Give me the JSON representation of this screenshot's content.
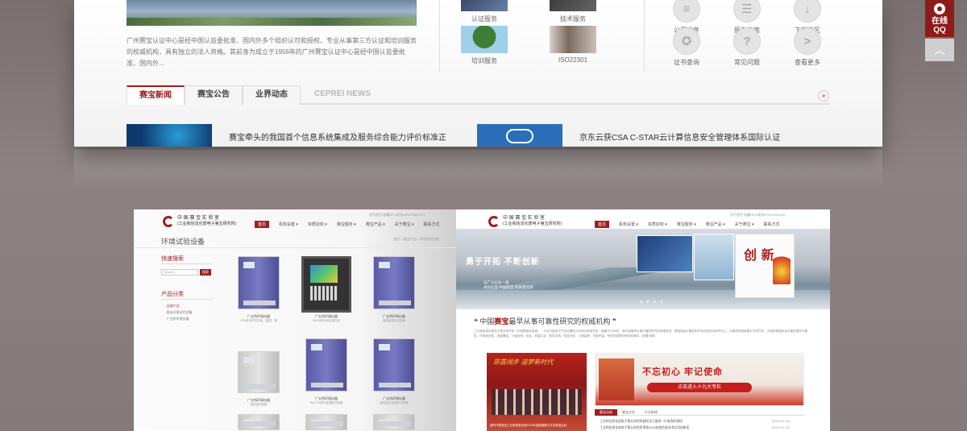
{
  "top": {
    "intro": "广州赛宝认证中心是经中国认监委批准、国内外多个组织认可和授权、专业从事第三方认证和培训服务的权威机构，具有独立的法人资格。其前身为成立于1956年的广州赛宝认证中心是经中国认监委批准、国内外...",
    "services": [
      {
        "label": "认证服务"
      },
      {
        "label": "技术服务"
      },
      {
        "label": "培训服务"
      },
      {
        "label": "ISO22301"
      }
    ],
    "icons": [
      {
        "label": "公开文件",
        "icon": "document-icon"
      },
      {
        "label": "服务指南",
        "icon": "guide-icon"
      },
      {
        "label": "下载专区",
        "icon": "download-icon"
      },
      {
        "label": "证书查询",
        "icon": "certificate-icon"
      },
      {
        "label": "常见问题",
        "icon": "question-icon"
      },
      {
        "label": "查看更多",
        "icon": "chevron-right-icon",
        "glyph": ">"
      }
    ],
    "side_qq": {
      "line1": "在线",
      "line2": "QQ"
    },
    "side_top_glyph": "︿",
    "tabs": [
      "赛宝新闻",
      "赛宝公告",
      "业界动态",
      "CEPREI NEWS"
    ],
    "tab_more": "»",
    "news": [
      {
        "title": "赛宝牵头的我国首个信息系统集成及服务综合能力评价标准正"
      },
      {
        "title": "京东云获CSA C-STAR云计算信息安全管理体系国际认证"
      }
    ],
    "colors": {
      "brand": "#a01d1d"
    }
  },
  "left_screen": {
    "logo_line1": "中 国 赛 宝 实 验 室",
    "logo_line2": "(工业和信息化部电子第五研究所)",
    "toplinks": "设为首页   收藏OPA   联系OPA   ENGLISH",
    "nav": [
      "首页",
      "机构设置 ▾",
      "资质授权 ▾",
      "赛宝服务 ▾",
      "赛宝产品 ▾",
      "关于赛宝 ▾",
      "联系方式"
    ],
    "page_title": "环境试验设备",
    "crumb": "首页 > 赛宝产品 > 环境试验设备",
    "quick_search": "快速搜索",
    "search_placeholder": "Search",
    "search_btn": "搜索",
    "category_title": "产品分类",
    "categories": [
      "·  全部产品",
      "·  赛宝环境试验设备",
      "·  广五所环境仪器"
    ],
    "products": [
      {
        "name": "广五所环境仪器",
        "spec": "XFN系列环境试验（温湿）箱"
      },
      {
        "name": "广五所环境仪器",
        "spec": "FA630系列综合测控仪"
      },
      {
        "name": "广五所环境仪器",
        "spec": "高低温湿热试验箱"
      },
      {
        "name": "广五所环境仪器",
        "spec": "高低温试验箱"
      },
      {
        "name": "广五所环境仪器",
        "spec": "MG-F15系列温湿度试验箱"
      },
      {
        "name": "广五所环境仪器",
        "spec": "高低温交变湿热试验箱"
      }
    ]
  },
  "right_screen": {
    "logo_line1": "中 国 赛 宝 实 验 室",
    "logo_line2": "(工业和信息化部电子第五研究所)",
    "toplinks": "设为首页   收藏OPA   联系OPA   ENGLISH",
    "nav": [
      "首页",
      "机构设置 ▾",
      "资质授权 ▾",
      "赛宝服务 ▾",
      "赛宝产品 ▾",
      "关于赛宝 ▾",
      "联系方式"
    ],
    "banner_slogan": "勇于开拓  不断创新",
    "banner_sub1": "与广大企业一道",
    "banner_sub2": "共同打造“中国智造”的质量品牌",
    "banner_card_title": "创 新",
    "banner_dots": "● ● ● ●",
    "auth_prefix": "❝ 中国",
    "auth_highlight": "赛宝",
    "auth_suffix": "最早从事可靠性研究的权威机构 ❞",
    "auth_text": "工业和信息化部电子第五研究所（中国赛宝实验室），又名中国电子产品可靠性与环境试验研究所，始建于1955年，是中国最早从事可靠性研究的权威机构，是国家级可靠性和环境试验技术研究中心，长期承担国家重大专项任务，为国防和国民经济建设提供可靠性、环境适应性、电磁兼容、计量检测、标准、质量认证、软件评测、信息安全、工程监理、节能环保、专利信息服务等技术服务。[查看详细]",
    "thumb1_caption": "昂首阔步  追梦新时代",
    "thumb1_text": "我所代表参加工业和信息化部2019年迎新春群众文化联谊活动",
    "thumb2_big": "不忘初心  牢记使命",
    "thumb2_btn": "点击进入十九大专栏",
    "tabs": [
      "赛宝动态",
      "赛宝文化",
      "行业新闻"
    ],
    "news": [
      {
        "title": "·  工业和信息化部电子第五研究所副所长王蕴伟一行来我所调研",
        "date": "(2019-02-26)"
      },
      {
        "title": "·  工业和信息化部电子第五研究所荣获2018年度信息技术应用创新奖",
        "date": "(2019-02-21)"
      }
    ]
  }
}
